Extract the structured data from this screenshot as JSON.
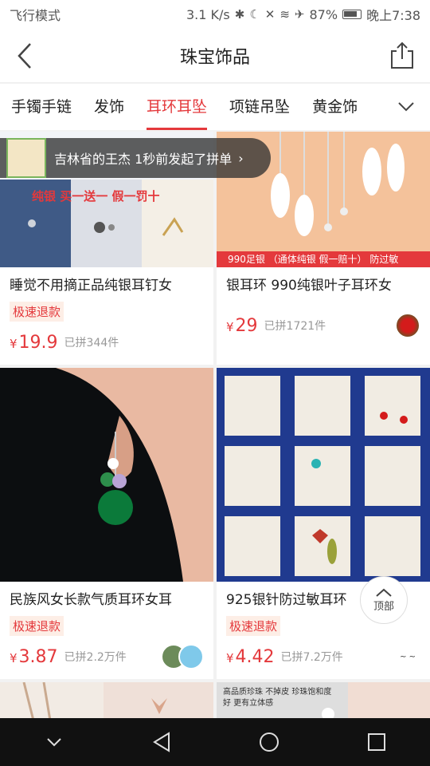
{
  "status": {
    "left": "飞行模式",
    "speed": "3.1 K/s",
    "battery": "87%",
    "time": "晚上7:38"
  },
  "header": {
    "title": "珠宝饰品"
  },
  "tabs": [
    {
      "label": "手镯手链"
    },
    {
      "label": "发饰"
    },
    {
      "label": "耳环耳坠"
    },
    {
      "label": "项链吊坠"
    },
    {
      "label": "黄金饰"
    }
  ],
  "notice": {
    "text": "吉林省的王杰 1秒前发起了拼单"
  },
  "products": [
    {
      "title": "睡觉不用摘正品纯银耳钉女",
      "badge": "极速退款",
      "price": "19.9",
      "sold": "已拼344件",
      "overlay": "纯银 买一送一 假一罚十"
    },
    {
      "title": "银耳环 990纯银叶子耳环女",
      "badge": "",
      "price": "29",
      "sold": "已拼1721件",
      "overlay": "990足银 （通体纯银 假一赔十） 防过敏"
    },
    {
      "title": "民族风女长款气质耳环女耳",
      "badge": "极速退款",
      "price": "3.87",
      "sold": "已拼2.2万件"
    },
    {
      "title": "925银针防过敏耳环",
      "badge": "极速退款",
      "price": "4.42",
      "sold": "已拼7.2万件"
    }
  ],
  "bottom_images": [
    {
      "caption": ""
    },
    {
      "caption": "高品质珍珠 不掉皮 珍珠饱和度好 更有立体感"
    }
  ],
  "to_top_label": "顶部",
  "currency": "¥",
  "colors": {
    "accent": "#e4393c",
    "badge_bg": "#fdeee6"
  }
}
